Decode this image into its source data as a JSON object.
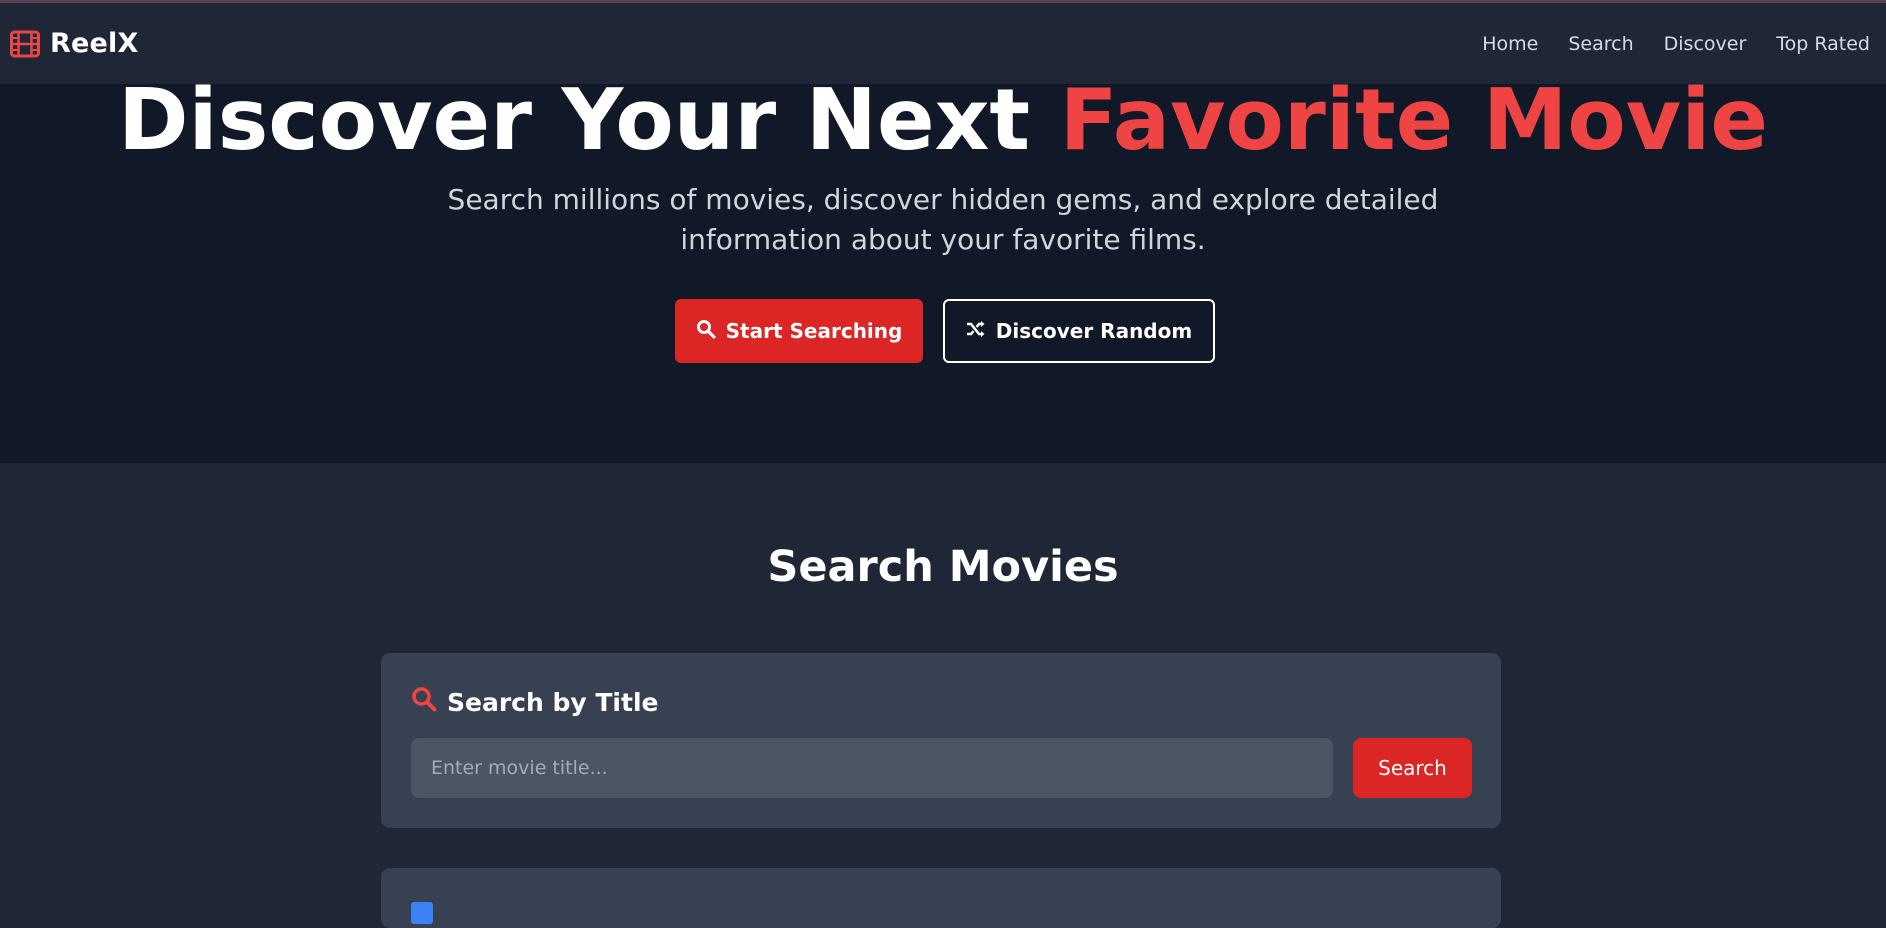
{
  "brand": {
    "name": "ReelX",
    "icon": "film-icon",
    "accent_color": "#ef4444"
  },
  "nav": {
    "links": [
      {
        "label": "Home"
      },
      {
        "label": "Search"
      },
      {
        "label": "Discover"
      },
      {
        "label": "Top Rated"
      }
    ]
  },
  "hero": {
    "title_main": "Discover Your Next ",
    "title_accent": "Favorite Movie",
    "subtitle_line1": "Search millions of movies, discover hidden gems, and explore detailed",
    "subtitle_line2": "information about your favorite films.",
    "primary_button": {
      "label": "Start Searching",
      "icon": "search-icon",
      "color": "#dc2626"
    },
    "secondary_button": {
      "label": "Discover Random",
      "icon": "shuffle-icon"
    }
  },
  "search_section": {
    "title": "Search Movies",
    "title_card": {
      "heading": "Search by Title",
      "icon": "search-icon",
      "placeholder": "Enter movie title...",
      "value": "",
      "button_label": "Search"
    },
    "next_card": {
      "icon": "list-icon",
      "icon_color": "#3b82f6"
    }
  }
}
